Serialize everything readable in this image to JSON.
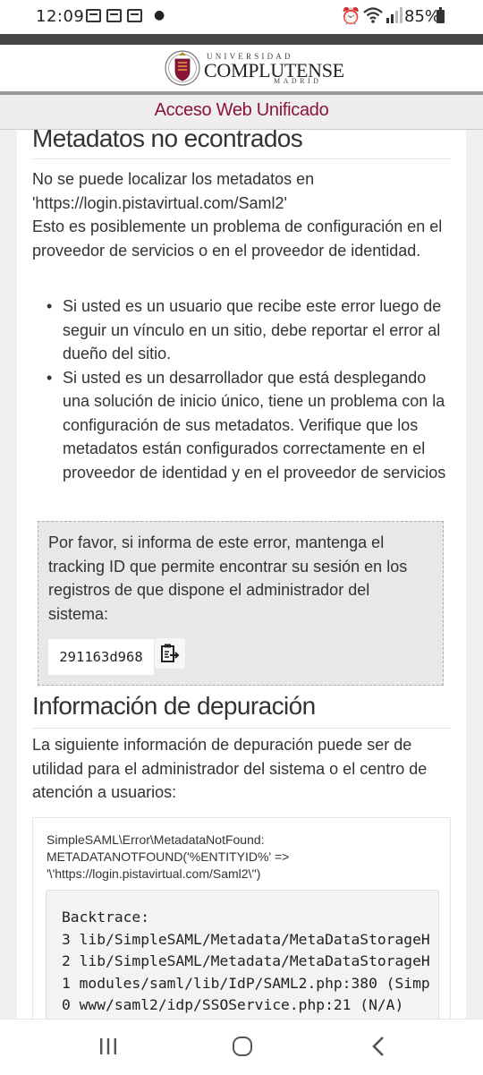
{
  "status_bar": {
    "time": "12:09",
    "battery_percent": "85%",
    "icons": [
      "notification-icon",
      "notification-icon",
      "notification-icon",
      "alarm-icon",
      "wifi-icon",
      "signal-icon",
      "battery-icon"
    ]
  },
  "header": {
    "brand_top": "UNIVERSIDAD",
    "brand_main": "COMPLUTENSE",
    "brand_bottom": "MADRID",
    "title": "Acceso Web Unificado"
  },
  "error": {
    "heading": "Metadatos no econtrados",
    "intro_line1": "No se puede localizar los metadatos en",
    "intro_line2": "'https://login.pistavirtual.com/Saml2'",
    "intro_line3": "Esto es posiblemente un problema de configuración en el proveedor de servicios o en el proveedor de identidad.",
    "bullets": [
      "Si usted es un usuario que recibe este error luego de seguir un vínculo en un sitio, debe reportar el error al dueño del sitio.",
      "Si usted es un desarrollador que está desplegando una solución de inicio único, tiene un problema con la configuración de sus metadatos. Verifique que los metadatos están configurados correctamente en el proveedor de identidad y en el proveedor de servicios"
    ],
    "tracking_text": "Por favor, si informa de este error, mantenga el tracking ID que permite encontrar su sesión en los registros de que dispone el administrador del sistema:",
    "tracking_id": "291163d968"
  },
  "debug": {
    "heading": "Información de depuración",
    "intro": "La siguiente información de depuración puede ser de utilidad para el administrador del sistema o el centro de atención a usuarios:",
    "exception_line1": "SimpleSAML\\Error\\MetadataNotFound:",
    "exception_line2": "METADATANOTFOUND('%ENTITYID%' =>",
    "exception_line3": "'\\'https://login.pistavirtual.com/Saml2\\'')",
    "backtrace_lines": [
      "Backtrace:",
      "3 lib/SimpleSAML/Metadata/MetaDataStorageH",
      "2 lib/SimpleSAML/Metadata/MetaDataStorageH",
      "1 modules/saml/lib/IdP/SAML2.php:380 (Simp",
      "0 www/saml2/idp/SSOService.php:21 (N/A)"
    ]
  },
  "colors": {
    "accent": "#8a1538",
    "header_strip": "#444444",
    "tracking_bg": "#e8e8e8"
  }
}
